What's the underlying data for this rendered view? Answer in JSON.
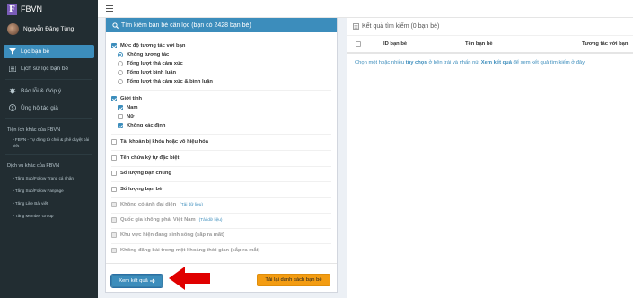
{
  "app": {
    "logo_letter": "F",
    "name": "FBVN"
  },
  "user": {
    "name": "Nguyễn Đăng Tùng"
  },
  "sidebar": {
    "items": [
      {
        "label": "Lọc bạn bè",
        "icon": "filter-icon",
        "active": true
      },
      {
        "label": "Lịch sử lọc bạn bè",
        "icon": "history-icon",
        "active": false
      },
      {
        "label": "Báo lỗi & Góp ý",
        "icon": "bug-icon",
        "active": false
      },
      {
        "label": "Ủng hộ tác giả",
        "icon": "donate-icon",
        "active": false
      }
    ],
    "section_other_ext": "Tiện ích khác của FBVN",
    "ext_items": [
      "FBVN - Tự động từ chối & phê duyệt bài viết"
    ],
    "section_services": "Dịch vụ khác của FBVN",
    "service_items": [
      "Tăng Sub/Follow Trang cá nhân",
      "Tăng Sub/Follow Fanpage",
      "Tăng Like Bài viết",
      "Tăng Member Group"
    ]
  },
  "filter_panel": {
    "title": "Tìm kiếm bạn bè cần lọc (bạn có 2428 bạn bè)",
    "groups": {
      "interaction": {
        "label": "Mức độ tương tác với bạn",
        "options": [
          "Không tương tác",
          "Tổng lượt thả cảm xúc",
          "Tổng lượt bình luận",
          "Tổng lượt thả cảm xúc & bình luận"
        ]
      },
      "gender": {
        "label": "Giới tính",
        "options": [
          "Nam",
          "Nữ",
          "Không xác định"
        ]
      }
    },
    "options": {
      "locked": "Tài khoản bị khóa hoặc vô hiệu hóa",
      "special_name": "Tên chứa ký tự đặc biệt",
      "mutual": "Số lượng bạn chung",
      "friend_count": "Số lượng bạn bè",
      "no_avatar": "Không có ảnh đại diện",
      "no_avatar_note": "(Tải dữ liệu)",
      "not_vn": "Quốc gia không phải Việt Nam",
      "not_vn_note": "(Tải dữ liệu)",
      "region": "Khu vực hiện đang sinh sống (sắp ra mắt)",
      "no_post": "Không đăng bài trong một khoảng thời gian (sắp ra mắt)"
    },
    "btn_view": "Xem kết quả",
    "btn_reload": "Tải lại danh sách bạn bè"
  },
  "result_panel": {
    "title": "Kết quả tìm kiếm (0 bạn bè)",
    "columns": [
      "ID bạn bè",
      "Tên bạn bè",
      "Tương tác với bạn"
    ],
    "hint_1": "Chọn một hoặc nhiều ",
    "hint_2": "tùy chọn",
    "hint_3": " ở bên trái và nhấn nút ",
    "hint_4": "Xem kết quả",
    "hint_5": " để xem kết quả tìm kiếm ở đây."
  },
  "colors": {
    "accent": "#3c8dbc",
    "sidebar": "#222d32",
    "warning": "#f39c12",
    "arrow": "#e00000"
  }
}
